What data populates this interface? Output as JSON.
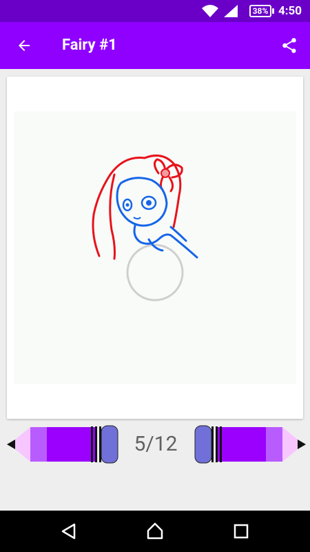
{
  "status_bar": {
    "battery": "38%",
    "time": "4:50",
    "icons": [
      "wifi-icon",
      "signal-icon",
      "battery-icon"
    ]
  },
  "app_bar": {
    "title": "Fairy #1",
    "back_icon": "arrow-left-icon",
    "share_icon": "share-icon"
  },
  "pager": {
    "counter": "5/12",
    "prev_icon": "pencil-left-icon",
    "next_icon": "pencil-right-icon"
  },
  "nav_bar": {
    "icons": [
      "back-triangle-icon",
      "home-icon",
      "recents-icon"
    ]
  },
  "colors": {
    "status_bar": "#6a00c8",
    "app_bar": "#8f00ff",
    "pencil_body": "#9b00ff",
    "pencil_cap": "#7070d8",
    "sketch_red": "#e8121a",
    "sketch_blue": "#1565e8"
  }
}
